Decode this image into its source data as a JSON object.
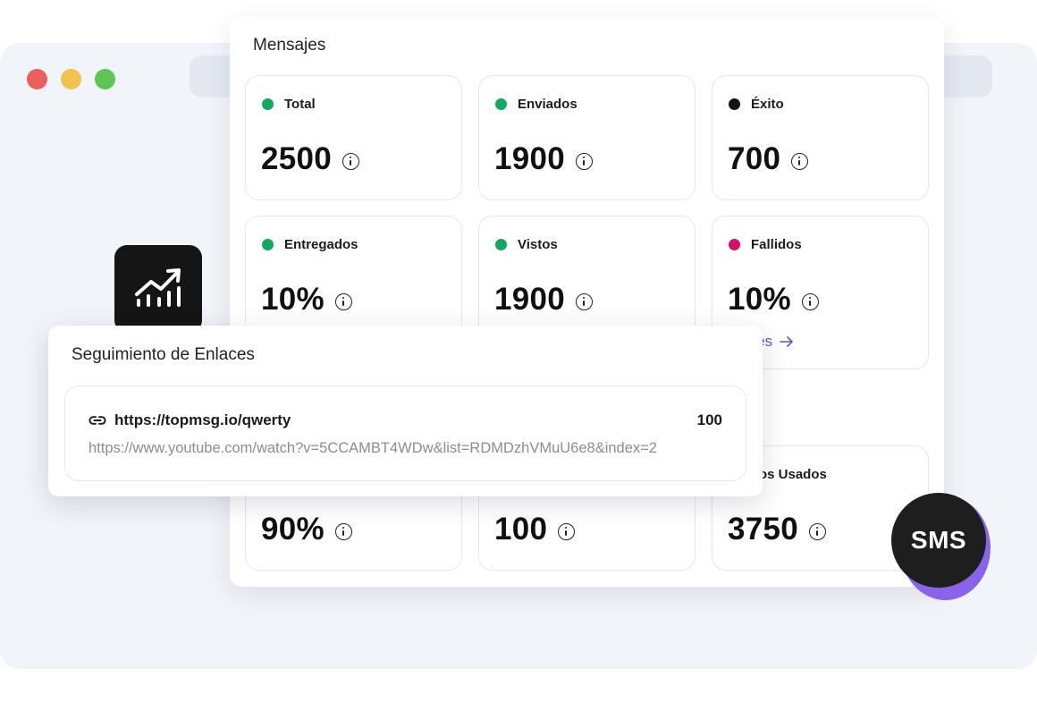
{
  "panel": {
    "title": "Mensajes"
  },
  "cards": [
    {
      "label": "Total",
      "value": "2500",
      "dot_color": "#11a862"
    },
    {
      "label": "Enviados",
      "value": "1900",
      "dot_color": "#11a862"
    },
    {
      "label": "Éxito",
      "value": "700",
      "dot_color": "#151515"
    },
    {
      "label": "Entregados",
      "value": "10%",
      "dot_color": "#11a862"
    },
    {
      "label": "Vistos",
      "value": "1900",
      "dot_color": "#11a862"
    },
    {
      "label": "Fallidos",
      "value": "10%",
      "dot_color": "#d5106a",
      "link_label": "nsajes"
    },
    {
      "label": "",
      "value": "90%"
    },
    {
      "label": "",
      "value": "100"
    },
    {
      "label": "tos Usados",
      "value": "3750"
    }
  ],
  "link_tracking": {
    "title": "Seguimiento de Enlaces",
    "short_url": "https://topmsg.io/qwerty",
    "clicks": "100",
    "long_url": "https://www.youtube.com/watch?v=5CCAMBT4WDw&list=RDMDzhVMuU6e8&index=2"
  },
  "badge": {
    "label": "SMS"
  },
  "icons": {
    "chart_tile": "trending-up-chart-icon",
    "info": "info-icon",
    "link": "link-icon",
    "arrow": "arrow-right-icon"
  },
  "colors": {
    "accent": "#6a4fc7",
    "success": "#11a862",
    "danger": "#d5106a",
    "badge_purple": "#8a63ea"
  }
}
